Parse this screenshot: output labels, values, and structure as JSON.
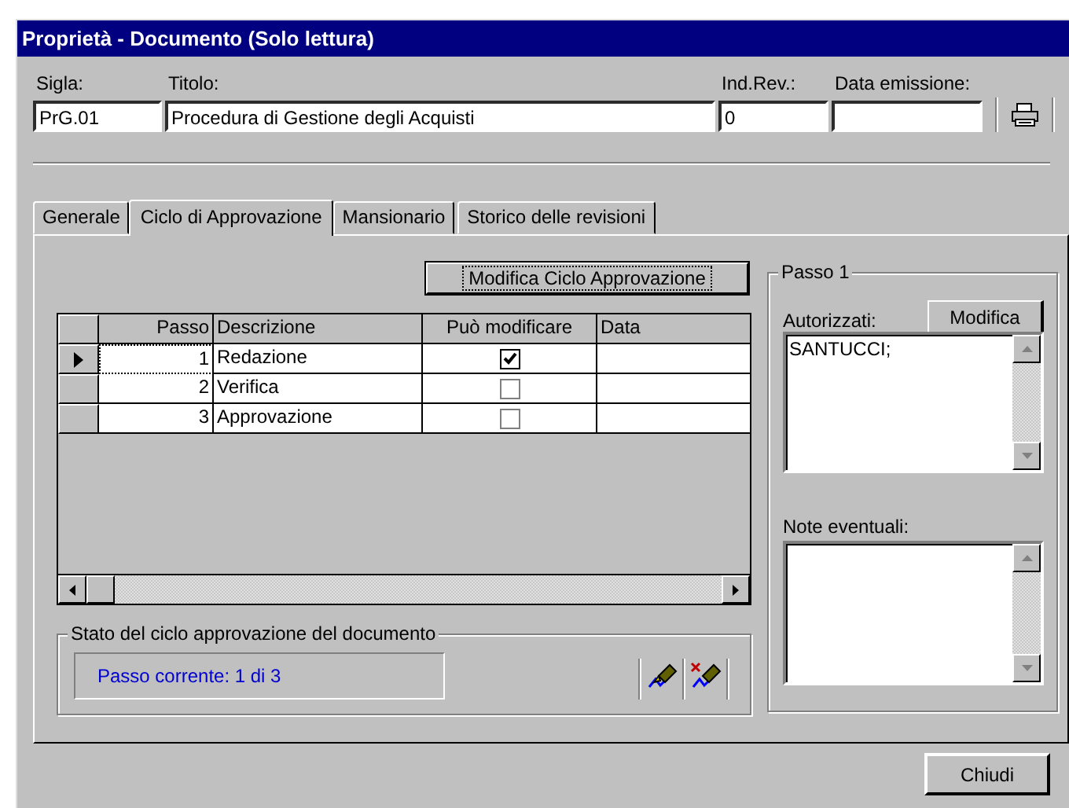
{
  "window": {
    "title": "Proprietà - Documento (Solo lettura)"
  },
  "fields": [
    {
      "label": "Sigla:",
      "value": "PrG.01"
    },
    {
      "label": "Titolo:",
      "value": "Procedura di Gestione degli Acquisti"
    },
    {
      "label": "Ind.Rev.:",
      "value": "0"
    },
    {
      "label": "Data emissione:"
    }
  ],
  "tabs": [
    {
      "label": "Generale",
      "selected": false
    },
    {
      "label": "Ciclo di Approvazione",
      "selected": true
    },
    {
      "label": "Mansionario",
      "selected": false
    },
    {
      "label": "Storico delle revisioni",
      "selected": false
    }
  ],
  "modify_cycle_button": "Modifica Ciclo Approvazione",
  "grid": {
    "columns": [
      "Passo",
      "Descrizione",
      "Può modificare",
      "Data"
    ],
    "rows": [
      {
        "step": "1",
        "description": "Redazione",
        "can_modify": true,
        "selected": true
      },
      {
        "step": "2",
        "description": "Verifica",
        "can_modify": false,
        "selected": false
      },
      {
        "step": "3",
        "description": "Approvazione",
        "can_modify": false,
        "selected": false
      }
    ]
  },
  "status_group": {
    "title": "Stato del ciclo approvazione del documento",
    "current_step": "Passo corrente: 1 di 3"
  },
  "step_panel": {
    "title": "Passo 1",
    "authorized_label": "Autorizzati:",
    "modify_button": "Modifica",
    "authorized_text": "SANTUCCI;",
    "notes_label": "Note eventuali:"
  },
  "close_button": "Chiudi"
}
